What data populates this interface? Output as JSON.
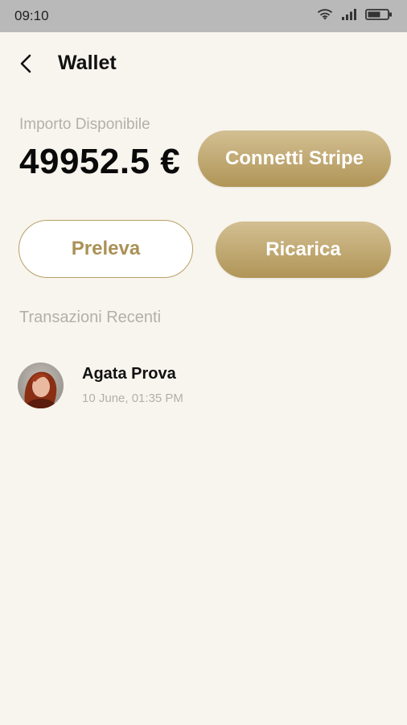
{
  "status_bar": {
    "time": "09:10",
    "icons": [
      "wifi-icon",
      "signal-icon",
      "battery-icon"
    ]
  },
  "header": {
    "back_icon": "chevron-left-icon",
    "title": "Wallet"
  },
  "balance": {
    "label": "Importo Disponibile",
    "value": "49952.5 €"
  },
  "actions": {
    "connect_stripe": "Connetti Stripe",
    "withdraw": "Preleva",
    "recharge": "Ricarica"
  },
  "transactions": {
    "title": "Transazioni Recenti",
    "items": [
      {
        "name": "Agata Prova",
        "date": "10 June, 01:35 PM",
        "avatar": "user-avatar"
      }
    ]
  },
  "colors": {
    "background": "#f8f5ee",
    "gold_light": "#d3bf92",
    "gold_dark": "#b09557",
    "muted_text": "#b3b0ab"
  }
}
